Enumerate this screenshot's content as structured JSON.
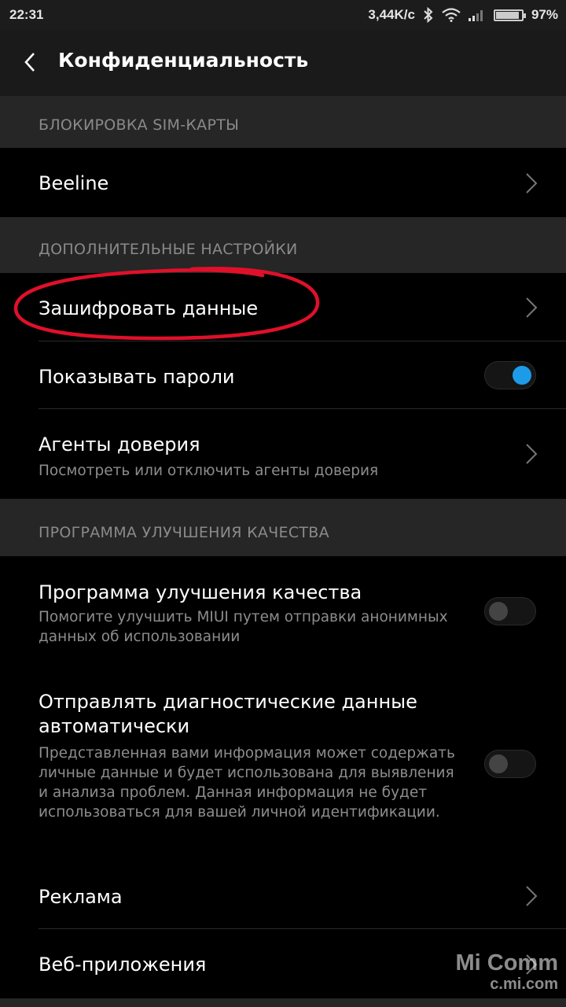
{
  "status_bar": {
    "time": "22:31",
    "speed": "3,44K/c",
    "battery": "97%",
    "battery_level": 0.97,
    "icons": [
      "bluetooth-icon",
      "wifi-icon",
      "signal-icon",
      "battery-icon"
    ]
  },
  "header": {
    "title": "Конфиденциальность",
    "back_icon": "chevron-left-icon"
  },
  "sections": {
    "sim_lock": {
      "label": "БЛОКИРОВКА SIM-КАРТЫ",
      "items": {
        "beeline": {
          "title": "Beeline"
        }
      }
    },
    "advanced": {
      "label": "ДОПОЛНИТЕЛЬНЫЕ НАСТРОЙКИ",
      "items": {
        "encrypt": {
          "title": "Зашифровать данные"
        },
        "show_passwords": {
          "title": "Показывать пароли",
          "enabled": true
        },
        "trust_agents": {
          "title": "Агенты доверия",
          "subtitle": "Посмотреть или отключить агенты доверия"
        }
      }
    },
    "quality": {
      "label": "ПРОГРАММА УЛУЧШЕНИЯ КАЧЕСТВА",
      "items": {
        "program": {
          "title": "Программа улучшения качества",
          "subtitle": "Помогите улучшить MIUI путем отправки анонимных данных об использовании",
          "enabled": false
        },
        "diagnostics": {
          "title": "Отправлять диагностические данные автоматически",
          "subtitle": "Представленная вами информация может содержать личные данные и будет использована для выявления и анализа проблем. Данная информация не будет использоваться для вашей личной идентификации.",
          "enabled": false
        },
        "ads": {
          "title": "Реклама"
        },
        "webapps": {
          "title": "Веб-приложения"
        }
      }
    }
  },
  "colors": {
    "accent": "#1e9be8",
    "annotation": "#e0102a",
    "background": "#000000",
    "section_bg": "#262626"
  },
  "watermark": {
    "line1": "Mi Comm",
    "line2": "c.mi.com"
  }
}
